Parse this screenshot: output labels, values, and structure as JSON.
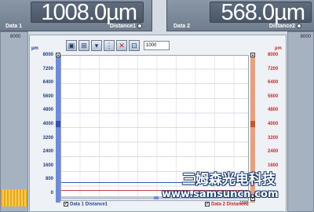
{
  "display_left": {
    "value": "1008.0",
    "unit": "µm",
    "name": "Data 1",
    "sensor": "Distance1"
  },
  "display_right": {
    "value": "568.0",
    "unit": "µm",
    "name": "Data 2",
    "sensor": "Distance2"
  },
  "side_left_tag": "8000",
  "side_right_tag": "8000",
  "toolbar": {
    "input_value": "1000"
  },
  "chart": {
    "unit_left": "µm",
    "unit_right": "µm",
    "x_end": "1000"
  },
  "y_ticks": [
    "8000",
    "7200",
    "6400",
    "5600",
    "4800",
    "4000",
    "3200",
    "2400",
    "1600",
    "800",
    "0"
  ],
  "legend": {
    "series1": "Data 1 Distance1",
    "series2": "Data 2 Distance2"
  },
  "watermark": {
    "cn": "三姆森光电科技",
    "url": "www.samsuncn.com"
  },
  "colors": {
    "series1": "#3050c8",
    "series2": "#d04040"
  },
  "chart_data": {
    "type": "line",
    "ylim": [
      0,
      8000
    ],
    "series": [
      {
        "name": "Data 1 Distance1",
        "values": [
          1008.0
        ]
      },
      {
        "name": "Data 2 Distance2",
        "values": [
          568.0
        ]
      }
    ]
  }
}
